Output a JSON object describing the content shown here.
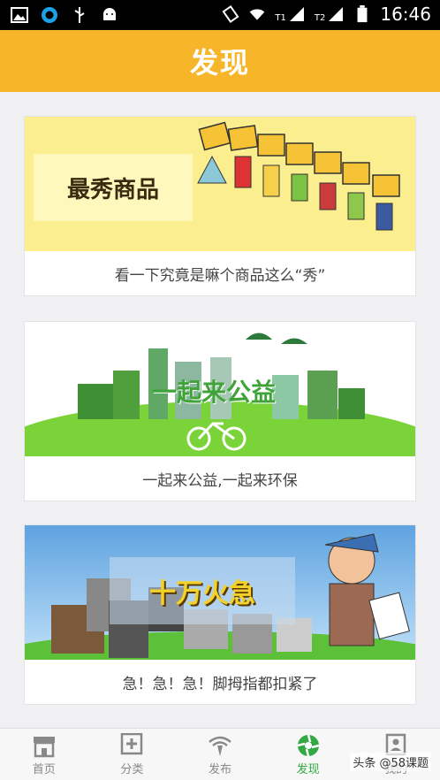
{
  "status_bar": {
    "time": "16:46",
    "sim1": "T1",
    "sim2": "T2"
  },
  "header": {
    "title": "发现"
  },
  "cards": [
    {
      "banner_text": "最秀商品",
      "caption": "看一下究竟是嘛个商品这么“秀”"
    },
    {
      "banner_text": "一起来公益",
      "caption": "一起来公益,一起来环保"
    },
    {
      "banner_text": "十万火急",
      "caption": "急！急！急！脚拇指都扣紧了"
    }
  ],
  "tabs": [
    {
      "label": "首页",
      "icon": "store-icon"
    },
    {
      "label": "分类",
      "icon": "add-square-icon"
    },
    {
      "label": "发布",
      "icon": "broadcast-icon"
    },
    {
      "label": "发现",
      "icon": "aperture-icon"
    },
    {
      "label": "我的",
      "icon": "profile-icon"
    }
  ],
  "watermark": "头条 @58课题",
  "colors": {
    "accent": "#f7b62a",
    "active_tab": "#33a944"
  }
}
